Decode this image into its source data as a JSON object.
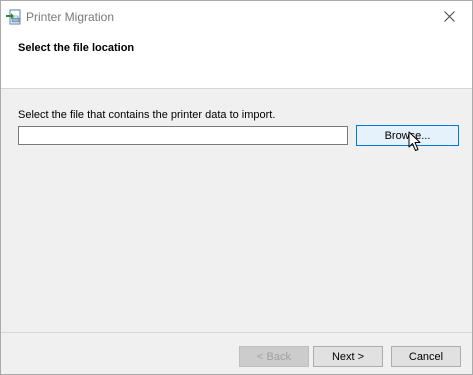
{
  "window": {
    "title": "Printer Migration",
    "app_icon": "printer-migration-icon",
    "close_icon": "close-icon"
  },
  "header": {
    "title": "Select the file location"
  },
  "main": {
    "instruction": "Select the file that contains the printer data to import.",
    "file_path_value": "",
    "browse_label": "Browse..."
  },
  "footer": {
    "back_label": "< Back",
    "back_enabled": false,
    "next_label": "Next >",
    "cancel_label": "Cancel"
  },
  "colors": {
    "dialog_bg": "#f0f0f0",
    "header_bg": "#ffffff",
    "focus_border": "#0078d7",
    "hover_bg": "#e5f1fb"
  }
}
